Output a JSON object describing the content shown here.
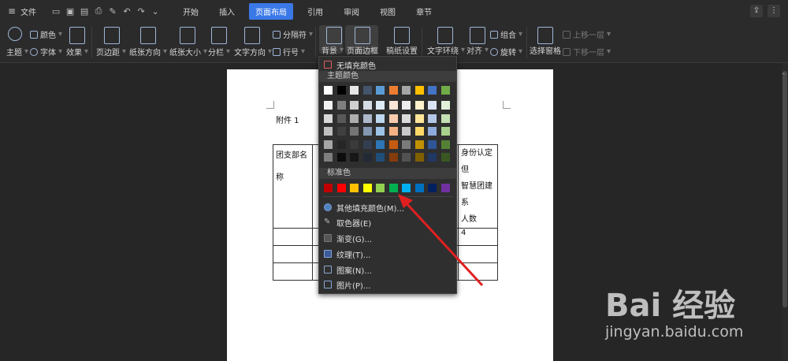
{
  "menubar": {
    "file": "文件",
    "tabs": [
      "开始",
      "插入",
      "页面布局",
      "引用",
      "审阅",
      "视图",
      "章节"
    ],
    "active_tab": "页面布局"
  },
  "ribbon": {
    "theme_color": "颜色",
    "theme": "主题",
    "font": "字体",
    "effect": "效果",
    "margin": "页边距",
    "orientation": "纸张方向",
    "size": "纸张大小",
    "columns": "分栏",
    "text_dir": "文字方向",
    "line_no": "行号",
    "breaks": "分隔符",
    "background": "背景",
    "page_border": "页面边框",
    "draft": "稿纸设置",
    "wrap": "文字环绕",
    "align": "对齐",
    "group": "组合",
    "rotate": "旋转",
    "select_pane": "选择窗格",
    "bring_forward": "上移一层",
    "send_backward": "下移一层"
  },
  "document": {
    "attachment": "附件 1",
    "row1_col1": "团支部名称",
    "row1_col1a": "团支部名",
    "row1_col1b": "称",
    "right_col_l1": "身份认定但",
    "right_col_l2": "智慧团建系",
    "right_col_l3": "人数",
    "value_4": "4"
  },
  "dropdown": {
    "no_fill": "无填充颜色",
    "theme_colors": "主题颜色",
    "standard_colors": "标准色",
    "more_colors": "其他填充颜色(M)...",
    "eyedropper": "取色器(E)",
    "gradient": "渐变(G)...",
    "texture": "纹理(T)...",
    "pattern": "图案(N)...",
    "picture": "图片(P)...",
    "theme_swatches": [
      [
        "#ffffff",
        "#000000",
        "#e6e6e6",
        "#44546a",
        "#5b9bd5",
        "#ed7d31",
        "#a5a5a5",
        "#ffc000",
        "#4472c4",
        "#70ad47"
      ],
      [
        "#f2f2f2",
        "#7f7f7f",
        "#d0d0d0",
        "#d6dce4",
        "#deebf7",
        "#fbe5d6",
        "#ededed",
        "#fff2cc",
        "#dae3f3",
        "#e2f0d9"
      ],
      [
        "#d9d9d9",
        "#595959",
        "#aeaeae",
        "#adb9ca",
        "#bdd7ee",
        "#f8cbad",
        "#dbdbdb",
        "#ffe699",
        "#b4c7e7",
        "#c5e0b4"
      ],
      [
        "#bfbfbf",
        "#404040",
        "#757575",
        "#8497b0",
        "#9dc3e6",
        "#f4b183",
        "#c9c9c9",
        "#ffd966",
        "#8faadc",
        "#a9d18e"
      ],
      [
        "#a6a6a6",
        "#262626",
        "#3a3a3a",
        "#333f50",
        "#2e75b6",
        "#c55a11",
        "#7b7b7b",
        "#bf9000",
        "#2f5597",
        "#548235"
      ],
      [
        "#7f7f7f",
        "#0d0d0d",
        "#171717",
        "#222a35",
        "#1f4e79",
        "#843c0c",
        "#525252",
        "#7f6000",
        "#203864",
        "#385723"
      ]
    ],
    "standard_swatches": [
      "#c00000",
      "#ff0000",
      "#ffc000",
      "#ffff00",
      "#92d050",
      "#00b050",
      "#00b0f0",
      "#0070c0",
      "#002060",
      "#7030a0"
    ]
  },
  "watermark": {
    "brand": "Bai 经验",
    "url": "jingyan.baidu.com"
  }
}
